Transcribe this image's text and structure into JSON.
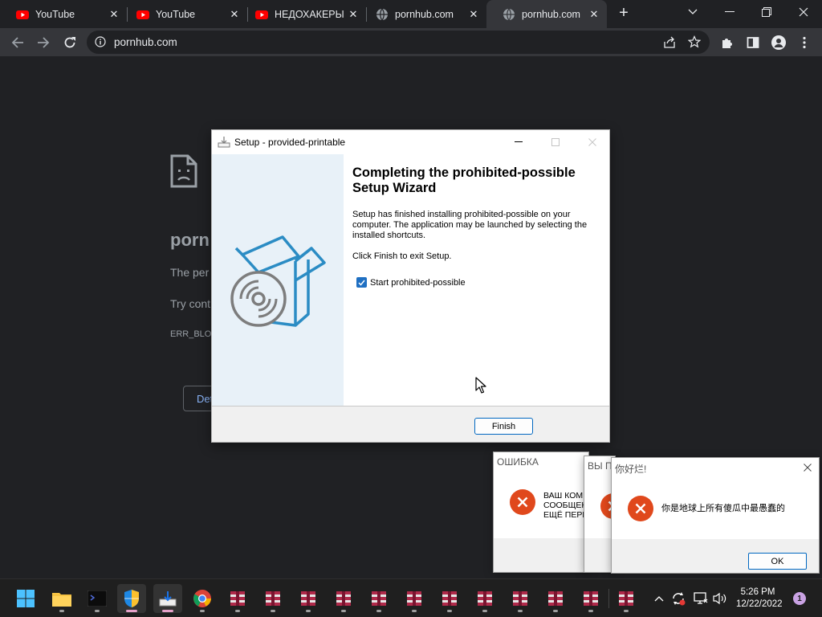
{
  "browser": {
    "tabs": [
      {
        "title": "YouTube",
        "favicon": "youtube-icon",
        "active": false
      },
      {
        "title": "YouTube",
        "favicon": "youtube-icon",
        "active": false
      },
      {
        "title": "НЕДОХАКЕРЫ L",
        "favicon": "youtube-icon",
        "active": false
      },
      {
        "title": "pornhub.com",
        "favicon": "globe-icon",
        "active": false
      },
      {
        "title": "pornhub.com",
        "favicon": "globe-icon",
        "active": true
      }
    ],
    "url": "pornhub.com",
    "colors": {
      "frame": "#202124",
      "toolbar": "#35363a",
      "omnibox": "#202124",
      "youtube_red": "#ff0000"
    }
  },
  "error_page": {
    "title": "porn",
    "text1": "The per",
    "text2": "Try cont",
    "code": "ERR_BLOC",
    "button_label": "Det"
  },
  "setup_dialog": {
    "title": "Setup - provided-printable",
    "heading": "Completing the prohibited-possible Setup Wizard",
    "paragraph": "Setup has finished installing prohibited-possible on your computer. The application may be launched by selecting the installed shortcuts.",
    "paragraph2": "Click Finish to exit Setup.",
    "checkbox_label": "Start prohibited-possible",
    "checkbox_checked": true,
    "finish_label": "Finish",
    "colors": {
      "sidebar": "#e8f1f8",
      "illustration": "#2b8cc4",
      "checkbox": "#1f6fc2"
    }
  },
  "message_boxes": [
    {
      "title": "ОШИБКА",
      "lines": [
        "ВАШ КОМ",
        "СООБЩЕН",
        "ЕЩЁ ПЕРЕ"
      ]
    },
    {
      "title": "ВЫ П",
      "lines": []
    },
    {
      "title": "你好烂!",
      "text": "你是地球上所有傻瓜中最愚蠢的",
      "ok_label": "OK"
    }
  ],
  "error_icon_color": "#e0481c",
  "taskbar": {
    "clock_time": "5:26 PM",
    "clock_date": "12/22/2022",
    "notification_count": "1",
    "items": [
      "start-icon",
      "file-explorer-icon",
      "terminal-icon",
      "security-shield-icon",
      "installer-icon",
      "chrome-icon",
      "rar-archive-icon",
      "rar-archive-icon",
      "rar-archive-icon",
      "rar-archive-icon",
      "rar-archive-icon",
      "rar-archive-icon",
      "rar-archive-icon",
      "rar-archive-icon",
      "rar-archive-icon",
      "rar-archive-icon",
      "rar-archive-icon",
      "rar-archive-icon"
    ]
  }
}
